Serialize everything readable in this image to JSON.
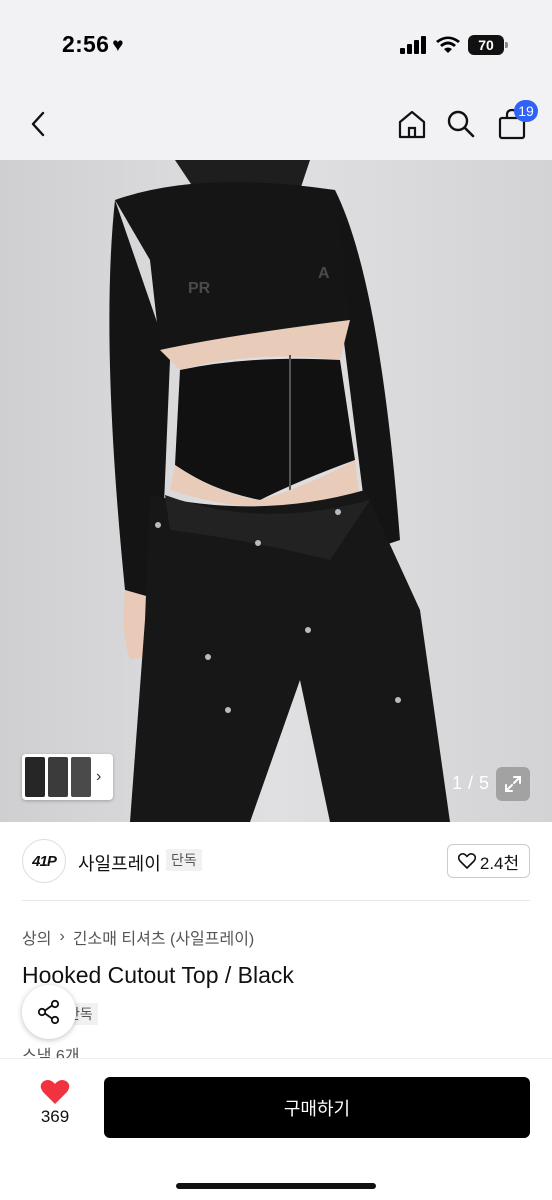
{
  "status": {
    "time": "2:56",
    "battery": "70"
  },
  "nav": {
    "cart_count": "19"
  },
  "gallery": {
    "counter": "1 / 5"
  },
  "brand": {
    "logo_text": "41P",
    "name": "사일프레이",
    "exclusive": "단독",
    "likes": "2.4천"
  },
  "product": {
    "breadcrumb": [
      "상의",
      "긴소매 티셔츠 (사일프레이)"
    ],
    "title": "Hooked Cutout Top / Black",
    "exclusive": "단독",
    "stock_partial": "스낵 6개"
  },
  "bottom": {
    "wish_count": "369",
    "buy_label": "구매하기"
  },
  "colors": {
    "accent": "#2f62f5",
    "wish": "#f1333f",
    "primary_button": "#000000"
  },
  "icons": [
    "back-icon",
    "home-icon",
    "search-icon",
    "cart-icon",
    "expand-icon",
    "share-icon",
    "heart-icon"
  ]
}
